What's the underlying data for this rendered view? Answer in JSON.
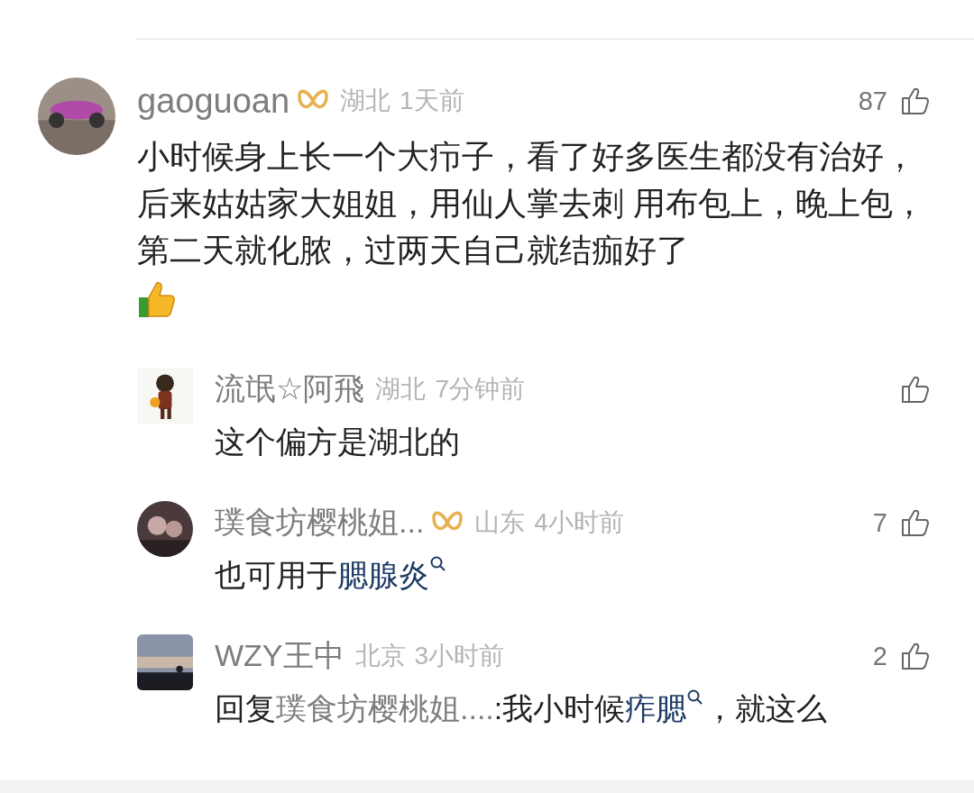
{
  "comments": [
    {
      "avatar": {
        "kind": "picture"
      },
      "name": "gaoguoan",
      "badge": true,
      "location": "湖北",
      "time": "1天前",
      "likes": "87",
      "body": [
        {
          "kind": "text",
          "text": "小时候身上长一个大疖子，看了好多医生都没有治好，后来姑姑家大姐姐，用仙人掌去刺 用布包上，晚上包，第二天就化脓，过两天自己就结痂好了"
        },
        {
          "kind": "emoji"
        }
      ],
      "replies": [
        {
          "avatar": {
            "kind": "picture"
          },
          "name": "流氓☆阿飛",
          "badge": false,
          "location": "湖北",
          "time": "7分钟前",
          "body": [
            {
              "kind": "text",
              "text": "这个偏方是湖北的"
            }
          ]
        },
        {
          "avatar": {
            "kind": "picture"
          },
          "name": "璞食坊樱桃姐...",
          "badge": true,
          "location": "山东",
          "time": "4小时前",
          "likes": "7",
          "body": [
            {
              "kind": "text",
              "text": "也可用于"
            },
            {
              "kind": "topic",
              "text": "腮腺炎"
            }
          ]
        },
        {
          "avatar": {
            "kind": "picture"
          },
          "name": "WZY王中",
          "badge": false,
          "location": "北京",
          "time": "3小时前",
          "likes": "2",
          "body": [
            {
              "kind": "text",
              "text": "回复"
            },
            {
              "kind": "mention",
              "text": "璞食坊樱桃姐...."
            },
            {
              "kind": "text",
              "text": ":我小时候"
            },
            {
              "kind": "topic",
              "text": "痄腮"
            },
            {
              "kind": "text",
              "text": "，就这么"
            }
          ]
        }
      ]
    }
  ]
}
